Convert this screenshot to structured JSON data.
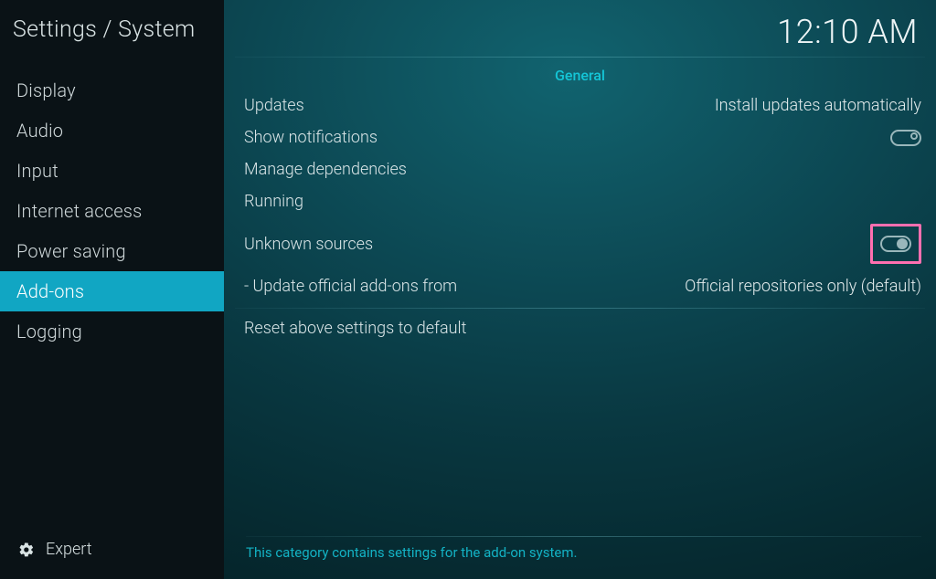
{
  "header": {
    "breadcrumb": "Settings / System",
    "clock": "12:10 AM"
  },
  "sidebar": {
    "items": [
      {
        "label": "Display",
        "active": false
      },
      {
        "label": "Audio",
        "active": false
      },
      {
        "label": "Input",
        "active": false
      },
      {
        "label": "Internet access",
        "active": false
      },
      {
        "label": "Power saving",
        "active": false
      },
      {
        "label": "Add-ons",
        "active": true
      },
      {
        "label": "Logging",
        "active": false
      }
    ],
    "level_label": "Expert"
  },
  "main": {
    "section_title": "General",
    "rows": [
      {
        "label": "Updates",
        "kind": "value",
        "value": "Install updates automatically"
      },
      {
        "label": "Show notifications",
        "kind": "toggle",
        "state": "off"
      },
      {
        "label": "Manage dependencies",
        "kind": "link"
      },
      {
        "label": "Running",
        "kind": "link"
      },
      {
        "label": "Unknown sources",
        "kind": "toggle",
        "state": "on",
        "highlighted": true
      },
      {
        "label": "Update official add-ons from",
        "kind": "value",
        "value": "Official repositories only (default)",
        "sub": true
      }
    ],
    "reset_label": "Reset above settings to default",
    "footer_help": "This category contains settings for the add-on system."
  }
}
